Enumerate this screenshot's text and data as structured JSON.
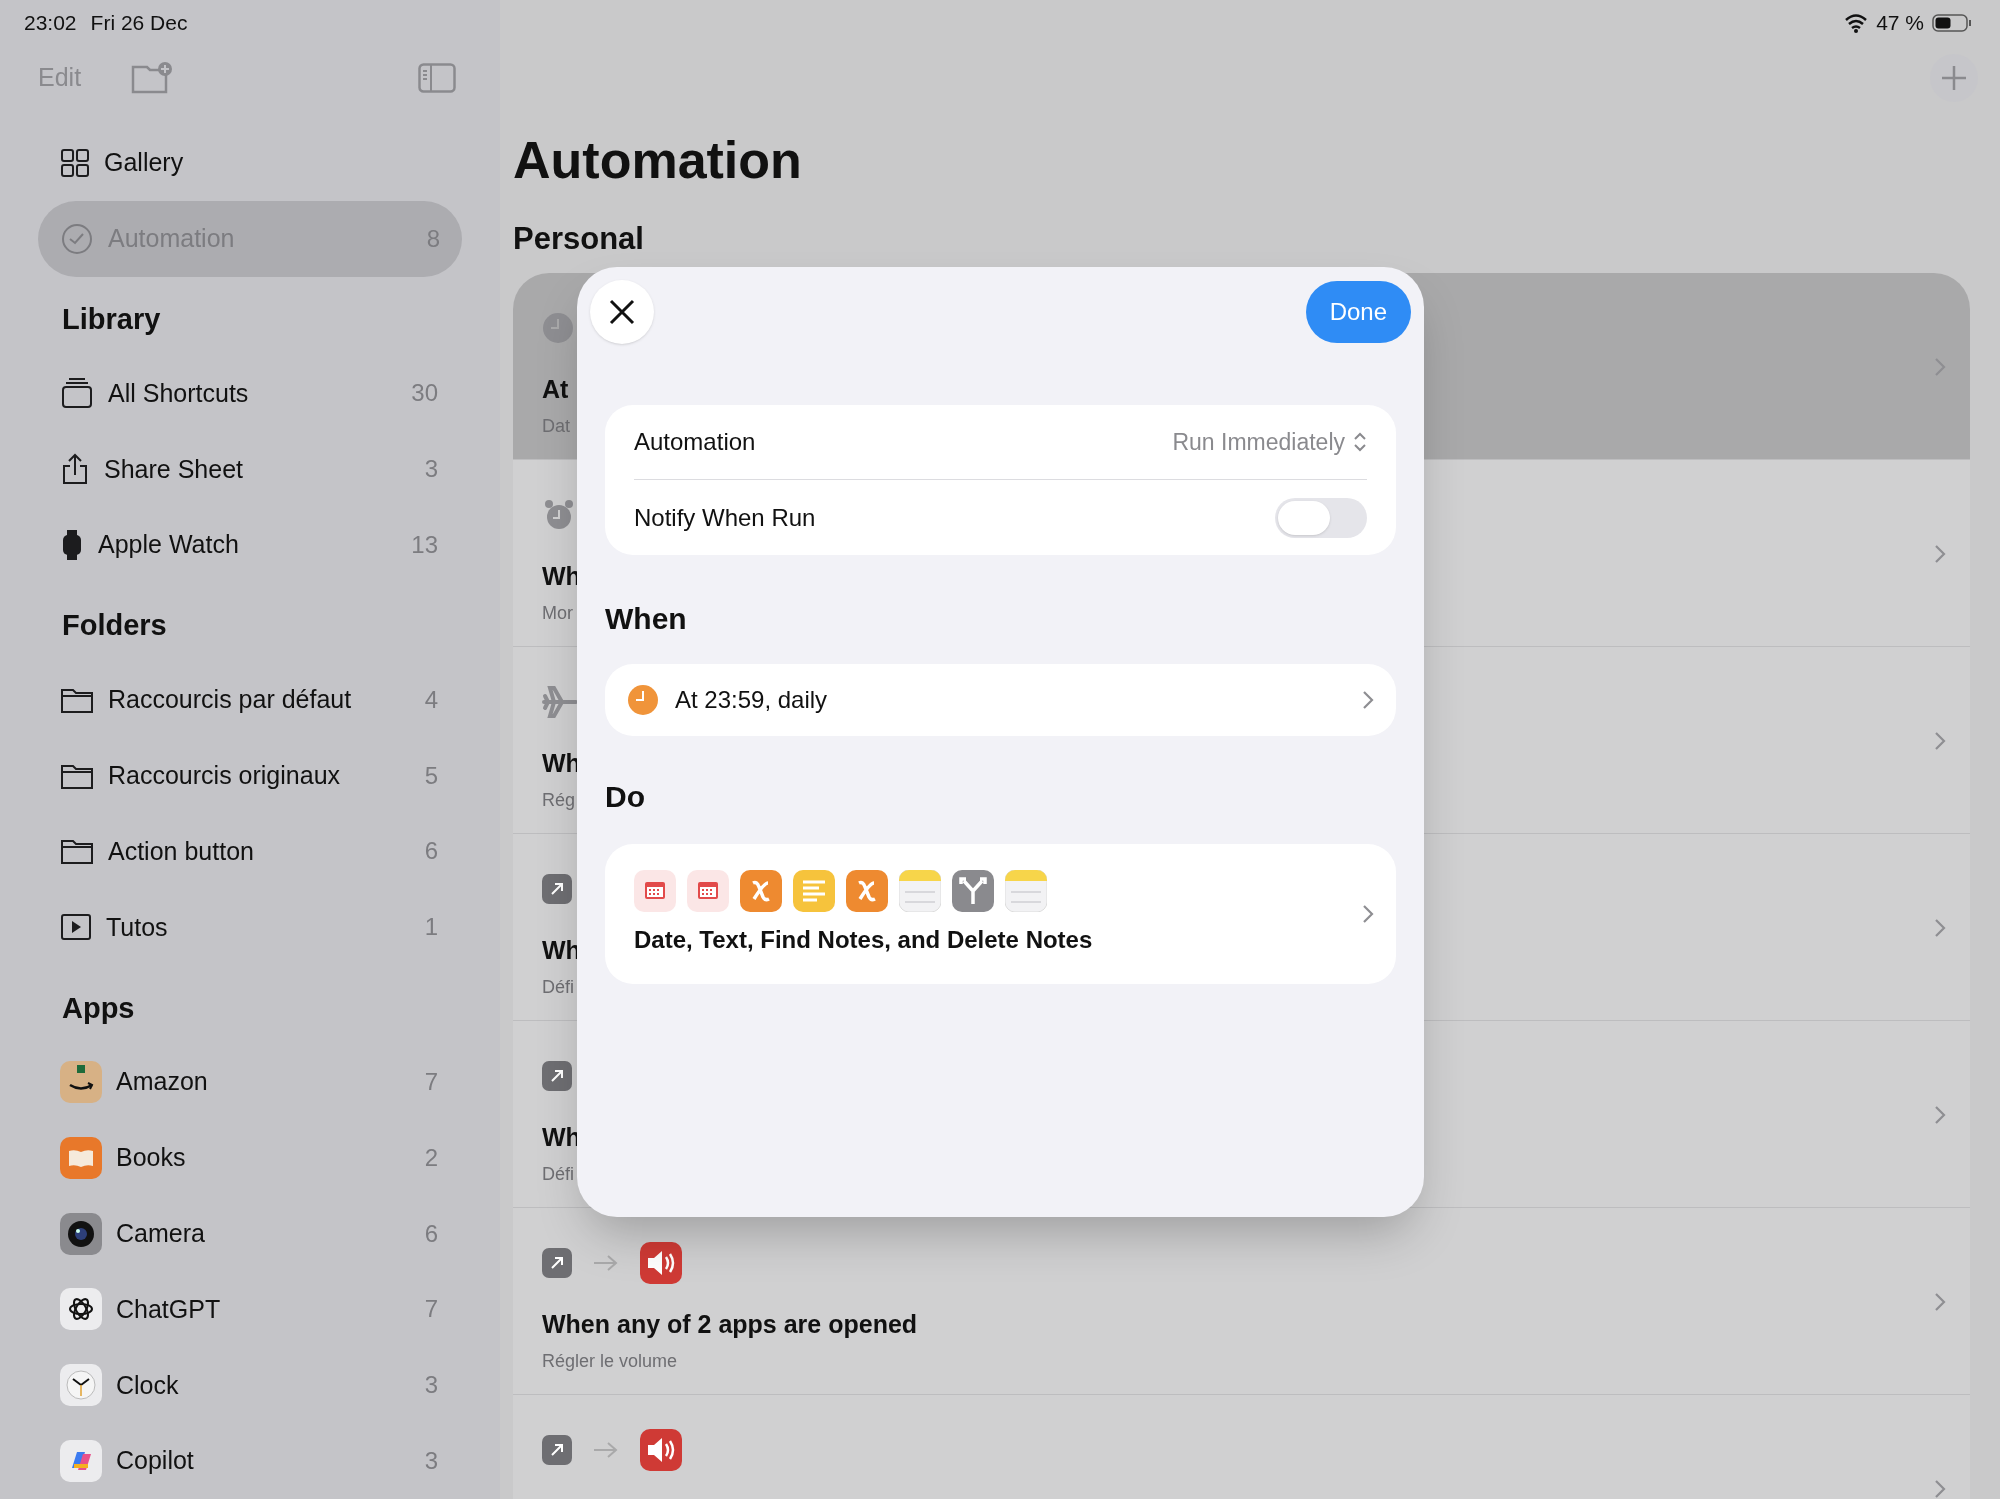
{
  "status_bar": {
    "time": "23:02",
    "date": "Fri 26 Dec",
    "battery": "47 %"
  },
  "sidebar": {
    "edit": "Edit",
    "nav": [
      {
        "label": "Gallery",
        "selected": false
      },
      {
        "label": "Automation",
        "count": "8",
        "selected": true
      }
    ],
    "sections": [
      {
        "title": "Library",
        "items": [
          {
            "label": "All Shortcuts",
            "count": "30"
          },
          {
            "label": "Share Sheet",
            "count": "3"
          },
          {
            "label": "Apple Watch",
            "count": "13"
          }
        ]
      },
      {
        "title": "Folders",
        "items": [
          {
            "label": "Raccourcis par défaut",
            "count": "4"
          },
          {
            "label": "Raccourcis originaux",
            "count": "5"
          },
          {
            "label": "Action button",
            "count": "6"
          },
          {
            "label": "Tutos",
            "count": "1"
          }
        ]
      },
      {
        "title": "Apps",
        "items": [
          {
            "label": "Amazon",
            "count": "7"
          },
          {
            "label": "Books",
            "count": "2"
          },
          {
            "label": "Camera",
            "count": "6"
          },
          {
            "label": "ChatGPT",
            "count": "7"
          },
          {
            "label": "Clock",
            "count": "3"
          },
          {
            "label": "Copilot",
            "count": "3"
          }
        ]
      }
    ]
  },
  "main": {
    "title": "Automation",
    "section": "Personal",
    "rows": [
      {
        "title": "At",
        "subtitle": "Dat",
        "selected": true
      },
      {
        "title": "Wh",
        "subtitle": "Mor",
        "selected": false
      },
      {
        "title": "Wh",
        "subtitle": "Rég",
        "selected": false
      },
      {
        "title": "Wh",
        "subtitle": "Défi",
        "selected": false
      },
      {
        "title": "Wh",
        "subtitle": "Défi",
        "selected": false
      },
      {
        "title": "When any of 2 apps are opened",
        "subtitle": "Régler le volume",
        "selected": false
      },
      {
        "selected": false
      }
    ]
  },
  "sheet": {
    "done": "Done",
    "settings": [
      {
        "kind": "picker",
        "label": "Automation",
        "value": "Run Immediately"
      },
      {
        "kind": "toggle",
        "label": "Notify When Run",
        "on": false
      }
    ],
    "when_title": "When",
    "when": "At 23:59, daily",
    "do_title": "Do",
    "actions": [
      {
        "kind": "calendar"
      },
      {
        "kind": "calendar"
      },
      {
        "kind": "variable"
      },
      {
        "kind": "text"
      },
      {
        "kind": "variable"
      },
      {
        "kind": "notes"
      },
      {
        "kind": "split"
      },
      {
        "kind": "notes"
      }
    ],
    "do_summary": "Date, Text, Find Notes, and Delete Notes"
  }
}
